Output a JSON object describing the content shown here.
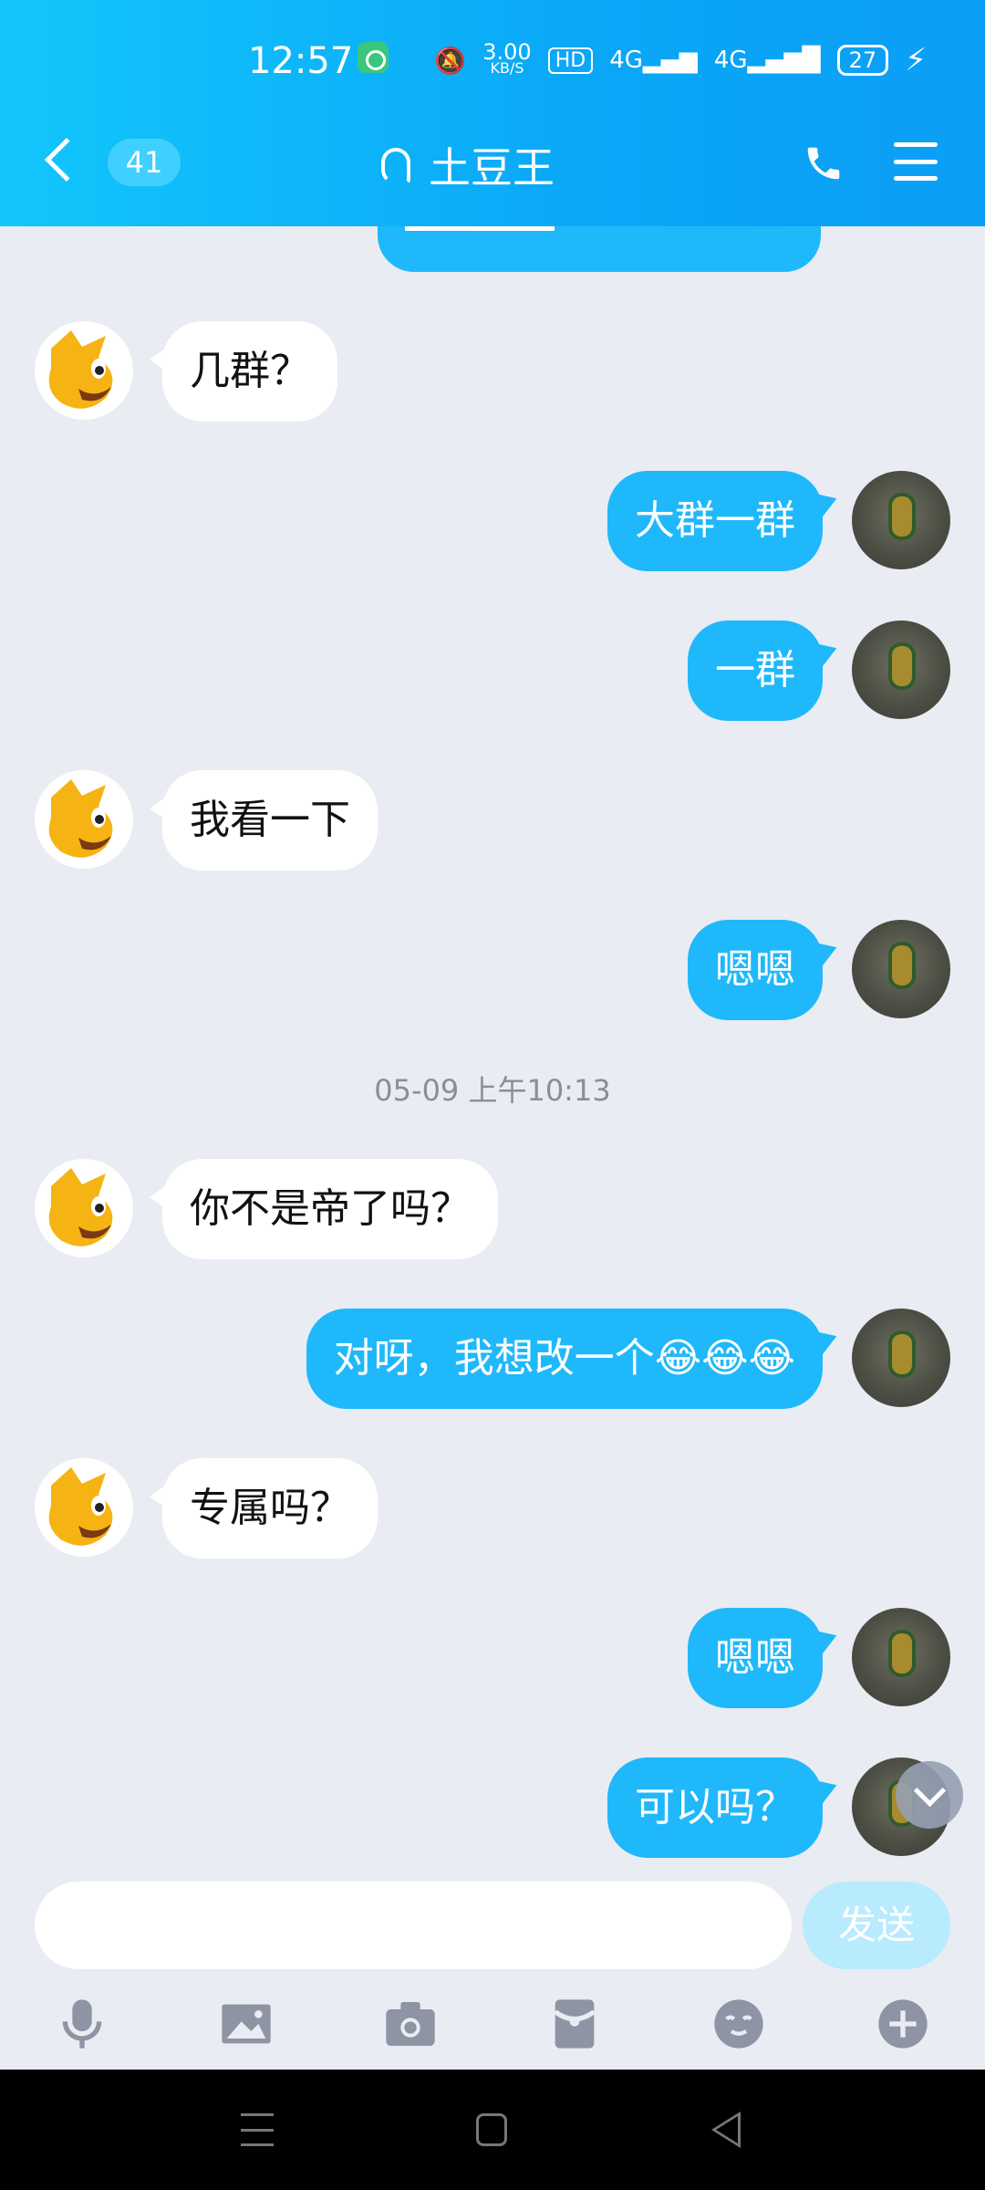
{
  "status_bar": {
    "time": "12:57",
    "net_speed": "3.00",
    "net_unit": "KB/S",
    "hd": "HD",
    "signal1": "4G",
    "signal2": "4G",
    "battery": "27"
  },
  "header": {
    "unread_count": "41",
    "title": "土豆王"
  },
  "messages": [
    {
      "side": "in",
      "text": "几群？"
    },
    {
      "side": "out",
      "text": "大群一群"
    },
    {
      "side": "out",
      "text": "一群"
    },
    {
      "side": "in",
      "text": "我看一下"
    },
    {
      "side": "out",
      "text": "嗯嗯"
    },
    {
      "side": "in",
      "text": "你不是帝了吗？"
    },
    {
      "side": "out",
      "text": "对呀，我想改一个😂😂😂"
    },
    {
      "side": "in",
      "text": "专属吗？"
    },
    {
      "side": "out",
      "text": "嗯嗯"
    },
    {
      "side": "out",
      "text": "可以吗？"
    }
  ],
  "timestamp": "05-09 上午10:13",
  "input": {
    "placeholder": "",
    "send_label": "发送"
  },
  "colors": {
    "header_gradient_start": "#12c6fb",
    "header_gradient_end": "#0b9ef5",
    "bubble_out": "#1fb8fb",
    "bubble_in": "#ffffff",
    "chat_bg": "#e9ecf3",
    "send_disabled": "#b8ebfd"
  },
  "icons": [
    "back-icon",
    "ear-icon",
    "phone-icon",
    "menu-icon",
    "mic-icon",
    "image-icon",
    "camera-icon",
    "red-packet-icon",
    "emoji-icon",
    "plus-icon",
    "chevron-down-icon"
  ]
}
